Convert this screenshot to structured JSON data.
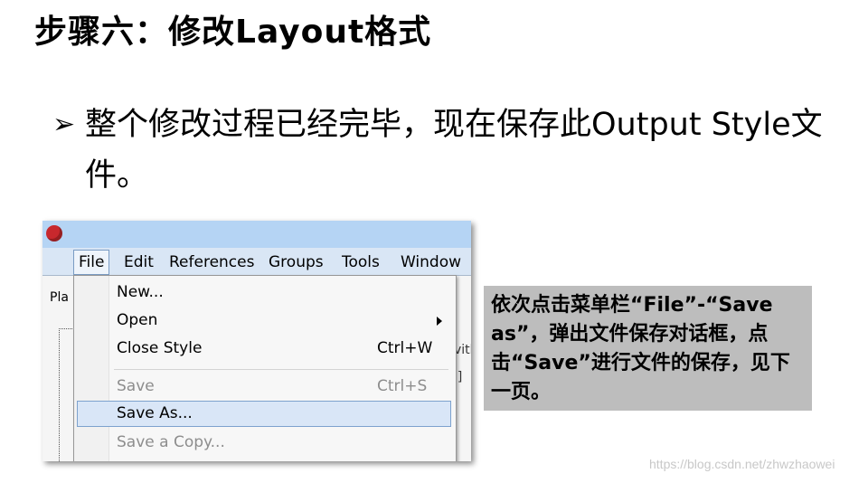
{
  "slide": {
    "title": "步骤六：修改Layout格式",
    "bullet_marker": "➢",
    "bullet_text": "整个修改过程已经完毕，现在保存此Output Style文件。"
  },
  "window": {
    "menubar": [
      "File",
      "Edit",
      "References",
      "Groups",
      "Tools",
      "Window"
    ],
    "toolbar_cut_text": "Pla",
    "right_cut_1": "vith",
    "right_cut_2": "l]"
  },
  "file_menu": {
    "items": [
      {
        "label": "New...",
        "shortcut": "",
        "disabled": false
      },
      {
        "label": "Open",
        "shortcut": "",
        "disabled": false,
        "submenu": true
      },
      {
        "label": "Close Style",
        "shortcut": "Ctrl+W",
        "disabled": false
      },
      {
        "label": "Save",
        "shortcut": "Ctrl+S",
        "disabled": true
      },
      {
        "label": "Save As...",
        "shortcut": "",
        "disabled": false,
        "highlighted": true
      },
      {
        "label": "Save a Copy...",
        "shortcut": "",
        "disabled": true
      }
    ]
  },
  "callout": {
    "text": "依次点击菜单栏“File”-“Save as”，弹出文件保存对话框，点击“Save”进行文件的保存，见下一页。"
  },
  "watermark": "https://blog.csdn.net/zhwzhaowei",
  "colors": {
    "titlebar": "#b5d4f4",
    "menubar": "#d9e6f5",
    "highlight": "#d9e6f7",
    "callout_bg": "#bdbdbd",
    "logo": "#c8282d"
  },
  "icons": {
    "app_logo": "endnote-logo-icon",
    "submenu": "chevron-right-icon"
  }
}
